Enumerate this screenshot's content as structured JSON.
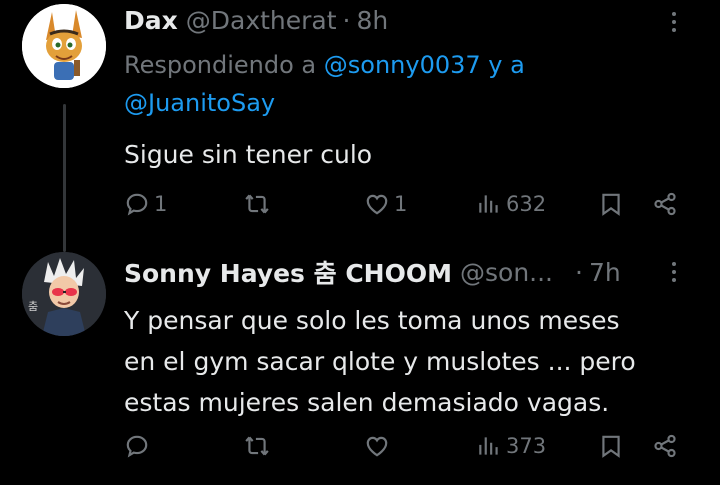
{
  "tweets": [
    {
      "name": "Dax",
      "handle": "@Daxtherat",
      "time": "8h",
      "replying_prefix": "Respondiendo a ",
      "replying_mention_1": "@sonny0037",
      "replying_join": " y a",
      "replying_mention_2": "@JuanitoSay",
      "text": "Sigue sin tener culo",
      "replies": "1",
      "retweets": "",
      "likes": "1",
      "views": "632"
    },
    {
      "name": "Sonny Hayes 춤 CHOOM",
      "handle": "@son...",
      "time": "7h",
      "text_line_1": "Y pensar que solo les toma unos meses",
      "text_line_2": "en el gym sacar qlote y muslotes ... pero",
      "text_line_3": "estas mujeres salen demasiado vagas.",
      "replies": "",
      "retweets": "",
      "likes": "",
      "views": "373"
    }
  ],
  "colors": {
    "background": "#000000",
    "text": "#e7e9ea",
    "muted": "#71767b",
    "link": "#1d9bf0",
    "thread_line": "#333639"
  },
  "icons": [
    "reply-icon",
    "retweet-icon",
    "like-icon",
    "views-icon",
    "bookmark-icon",
    "share-icon",
    "more-icon"
  ]
}
